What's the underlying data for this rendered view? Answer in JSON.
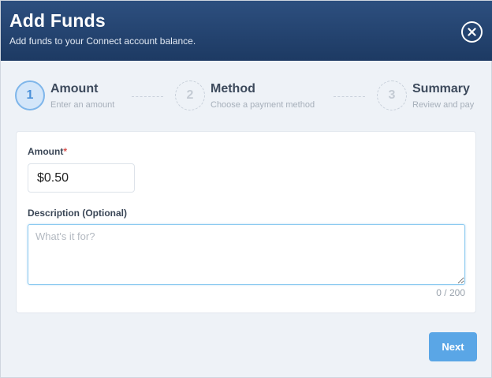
{
  "header": {
    "title": "Add Funds",
    "subtitle": "Add funds to your Connect account balance.",
    "close_icon": "close-circle-icon"
  },
  "steps": [
    {
      "number": "1",
      "title": "Amount",
      "subtitle": "Enter an amount",
      "active": true
    },
    {
      "number": "2",
      "title": "Method",
      "subtitle": "Choose a payment method",
      "active": false
    },
    {
      "number": "3",
      "title": "Summary",
      "subtitle": "Review and pay",
      "active": false
    }
  ],
  "form": {
    "amount_label": "Amount",
    "required_marker": "*",
    "amount_value": "$0.50",
    "description_label": "Description (Optional)",
    "description_value": "",
    "description_placeholder": "What's it for?",
    "char_counter": "0 / 200"
  },
  "footer": {
    "next_label": "Next"
  },
  "colors": {
    "header": "#1d3a63",
    "accent": "#5aa6e6",
    "required": "#d9534f"
  }
}
